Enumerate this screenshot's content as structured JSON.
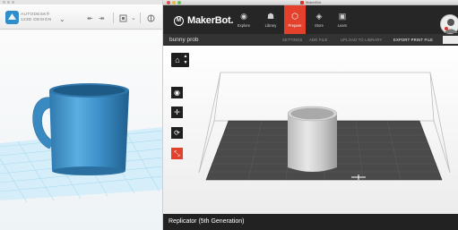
{
  "left_app": {
    "logo_text": "AUTODESK®\n123D DESIGN",
    "tools": [
      "↞",
      "↠"
    ]
  },
  "right_app": {
    "window_title": "MakerBot",
    "brand": "MakerBot.",
    "nav": [
      {
        "label": "Explore",
        "icon": "explore-icon"
      },
      {
        "label": "Library",
        "icon": "library-icon"
      },
      {
        "label": "Prepare",
        "icon": "prepare-icon",
        "active": true
      },
      {
        "label": "Store",
        "icon": "store-icon"
      },
      {
        "label": "Learn",
        "icon": "learn-icon"
      }
    ],
    "project_name": "bunny prob",
    "sub_buttons": [
      "SETTINGS",
      "ADD FILE",
      "UPLOAD TO LIBRARY",
      "EXPORT PRINT FILE"
    ],
    "status_text": "Replicator (5th Generation)"
  },
  "colors": {
    "accent": "#e3412b",
    "mug_blue": "#3f93cc",
    "grid_blue": "#7fc8ea",
    "nav_bg": "#262626"
  }
}
